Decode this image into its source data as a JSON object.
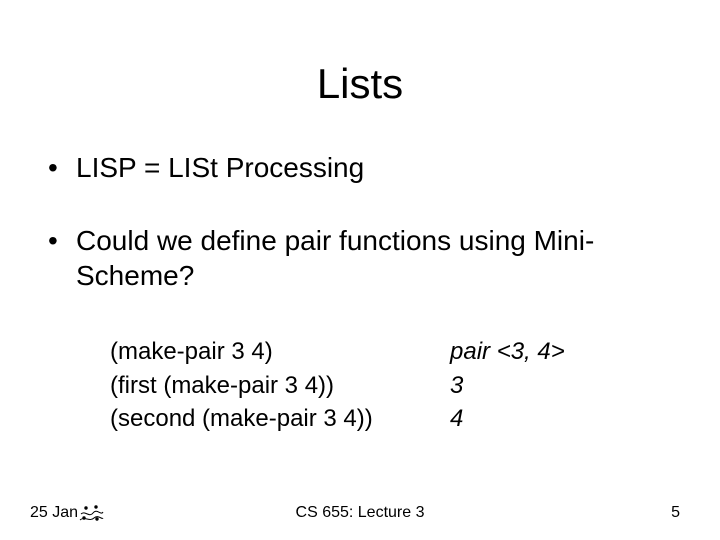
{
  "title": "Lists",
  "bullets": [
    {
      "text": "LISP = LISt Processing"
    },
    {
      "text": "Could we define pair functions using Mini-Scheme?"
    }
  ],
  "examples": [
    {
      "expr": "(make-pair 3 4)",
      "result": "pair <3, 4>"
    },
    {
      "expr": "(first (make-pair 3 4))",
      "result": "3"
    },
    {
      "expr": "(second (make-pair 3 4))",
      "result": "4"
    }
  ],
  "footer": {
    "date": "25 Jan",
    "center": "CS 655: Lecture 3",
    "page": "5"
  }
}
